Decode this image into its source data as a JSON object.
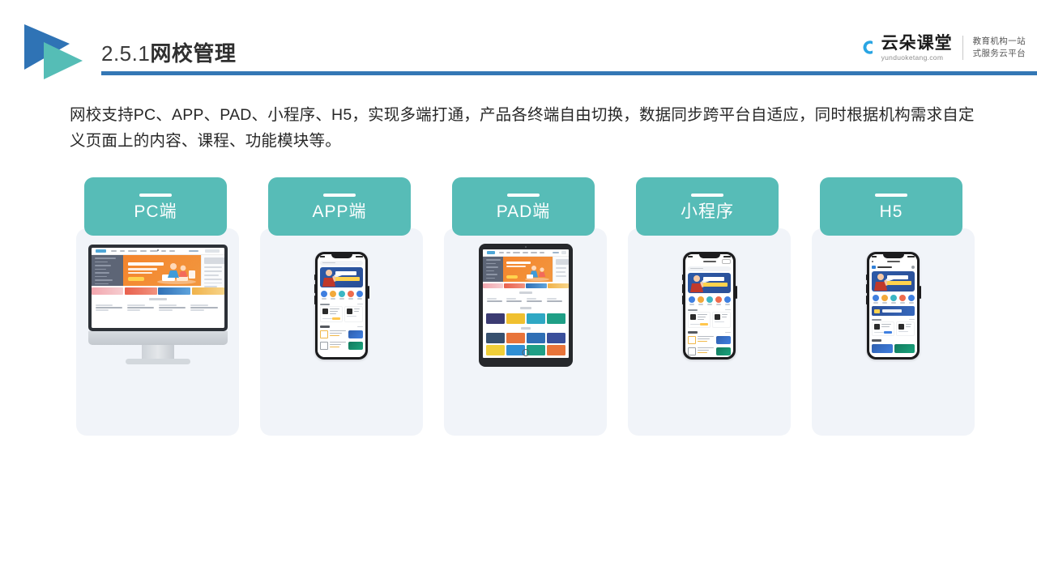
{
  "header": {
    "section_number": "2.5.1",
    "section_title": "网校管理",
    "rule_color": "#3477b5",
    "logo_icon": "double-triangle-play-logo",
    "logo_colors": {
      "primary": "#2f73b5",
      "secondary": "#55bdb6"
    }
  },
  "brand": {
    "icon": "cloud-icon",
    "name": "云朵课堂",
    "url": "yunduoketang.com",
    "tagline_line1": "教育机构一站",
    "tagline_line2": "式服务云平台",
    "accent": "#29a5e3"
  },
  "body_copy": "网校支持PC、APP、PAD、小程序、H5，实现多端打通，产品各终端自由切换，数据同步跨平台自适应，同时根据机构需求自定义页面上的内容、课程、功能模块等。",
  "cards": [
    {
      "label": "PC端",
      "device": "desktop-monitor",
      "icon": "desktop-icon"
    },
    {
      "label": "APP端",
      "device": "smartphone",
      "icon": "mobile-icon"
    },
    {
      "label": "PAD端",
      "device": "tablet",
      "icon": "tablet-icon"
    },
    {
      "label": "小程序",
      "device": "smartphone",
      "icon": "mini-program-icon"
    },
    {
      "label": "H5",
      "device": "smartphone",
      "icon": "h5-icon"
    }
  ],
  "theme": {
    "pill_color": "#57bcb7",
    "card_bg": "#f1f4f9",
    "text_color": "#272727",
    "page_bg": "#ffffff"
  }
}
